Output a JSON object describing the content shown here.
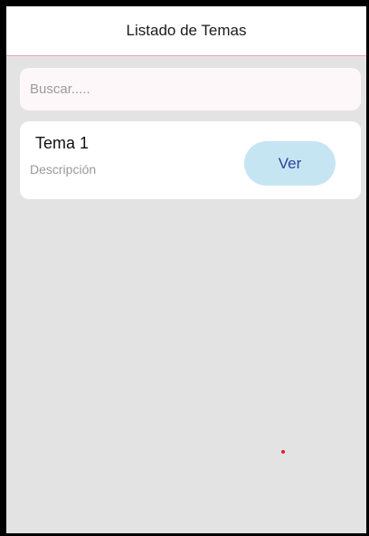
{
  "header": {
    "title": "Listado de Temas"
  },
  "search": {
    "placeholder": "Buscar.....",
    "value": ""
  },
  "topics": [
    {
      "title": "Tema 1",
      "description": "Descripción",
      "button_label": "Ver"
    }
  ],
  "colors": {
    "header_underline": "#e8a0c8",
    "background": "#e3e3e3",
    "button_bg": "#c6e5f2",
    "button_text": "#2f3f9e",
    "indicator_dot": "#e02020"
  }
}
